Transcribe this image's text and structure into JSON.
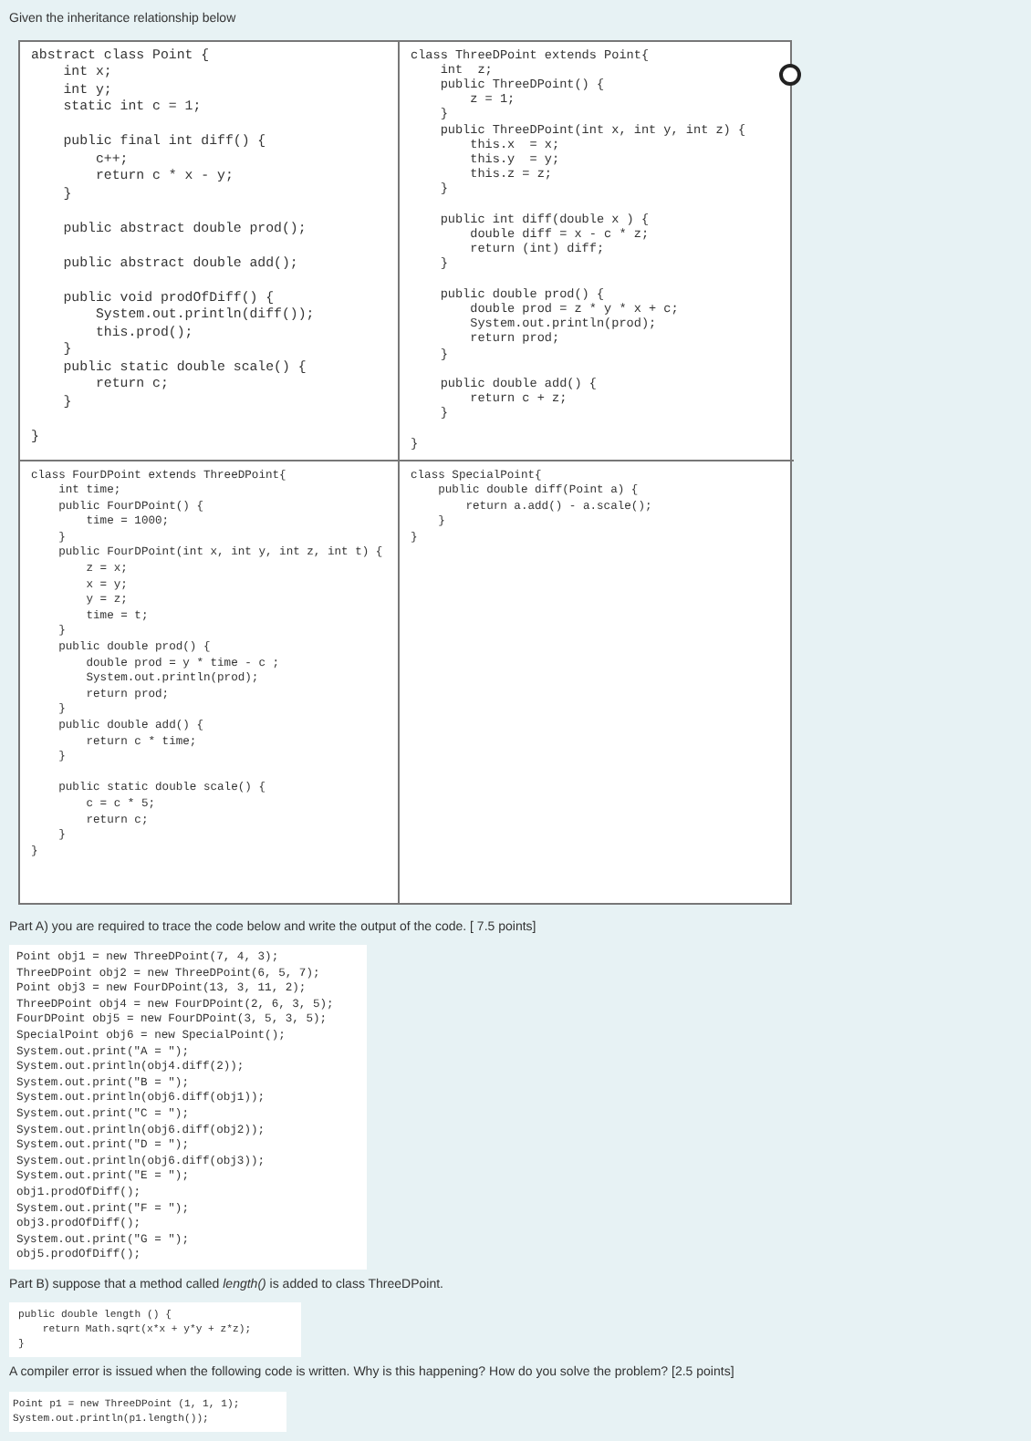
{
  "intro": "Given the inheritance relationship below",
  "classes": [
    {
      "code": "abstract class Point {\n    int x;\n    int y;\n    static int c = 1;\n\n    public final int diff() {\n        c++;\n        return c * x - y;\n    }\n\n    public abstract double prod();\n\n    public abstract double add();\n\n    public void prodOfDiff() {\n        System.out.println(diff());\n        this.prod();\n    }\n    public static double scale() {\n        return c;\n    }\n\n}"
    },
    {
      "code": "class ThreeDPoint extends Point{\n    int  z;\n    public ThreeDPoint() {\n        z = 1;\n    }\n    public ThreeDPoint(int x, int y, int z) {\n        this.x  = x;\n        this.y  = y;\n        this.z = z;\n    }\n\n    public int diff(double x ) {\n        double diff = x - c * z;\n        return (int) diff;\n    }\n\n    public double prod() {\n        double prod = z * y * x + c;\n        System.out.println(prod);\n        return prod;\n    }\n\n    public double add() {\n        return c + z;\n    }\n\n}"
    },
    {
      "code": "class FourDPoint extends ThreeDPoint{\n    int time;\n    public FourDPoint() {\n        time = 1000;\n    }\n    public FourDPoint(int x, int y, int z, int t) {\n        z = x;\n        x = y;\n        y = z;\n        time = t;\n    }\n    public double prod() {\n        double prod = y * time - c ;\n        System.out.println(prod);\n        return prod;\n    }\n    public double add() {\n        return c * time;\n    }\n\n    public static double scale() {\n        c = c * 5;\n        return c;\n    }\n}"
    },
    {
      "code": "class SpecialPoint{\n    public double diff(Point a) {\n        return a.add() - a.scale();\n    }\n}"
    }
  ],
  "option": {
    "selected": false
  },
  "part_a": {
    "question": "Part A) you are required to trace the code below and write the output of the code. [ 7.5 points]",
    "code": "Point obj1 = new ThreeDPoint(7, 4, 3);\nThreeDPoint obj2 = new ThreeDPoint(6, 5, 7);\nPoint obj3 = new FourDPoint(13, 3, 11, 2);\nThreeDPoint obj4 = new FourDPoint(2, 6, 3, 5);\nFourDPoint obj5 = new FourDPoint(3, 5, 3, 5);\nSpecialPoint obj6 = new SpecialPoint();\nSystem.out.print(\"A = \");\nSystem.out.println(obj4.diff(2));\nSystem.out.print(\"B = \");\nSystem.out.println(obj6.diff(obj1));\nSystem.out.print(\"C = \");\nSystem.out.println(obj6.diff(obj2));\nSystem.out.print(\"D = \");\nSystem.out.println(obj6.diff(obj3));\nSystem.out.print(\"E = \");\nobj1.prodOfDiff();\nSystem.out.print(\"F = \");\nobj3.prodOfDiff();\nSystem.out.print(\"G = \");\nobj5.prodOfDiff();"
  },
  "part_b": {
    "question": "Part B) suppose that a method called *length()* is added to class ThreeDPoint.",
    "code": "public double length () {\n    return Math.sqrt(x*x + y*y + z*z);\n}",
    "question_2": "A compiler error is issued when the following code is written. Why is this happening? How do you solve the problem? [2.5 points]",
    "code_2": "Point p1 = new ThreeDPoint (1, 1, 1);\nSystem.out.println(p1.length());"
  }
}
